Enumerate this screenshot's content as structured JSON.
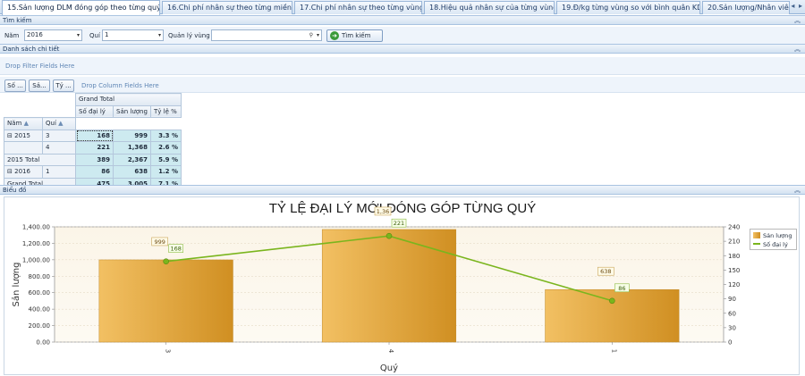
{
  "tabs": [
    {
      "label": "15.Sản lượng DLM đóng góp theo từng quý",
      "active": true
    },
    {
      "label": "16.Chi phí nhân sự theo từng miền",
      "active": false
    },
    {
      "label": "17.Chi phí nhân sự theo từng vùng",
      "active": false
    },
    {
      "label": "18.Hiệu quả nhân sự của từng vùng",
      "active": false
    },
    {
      "label": "19.Đ/kg từng vùng so với bình quân KD",
      "active": false
    },
    {
      "label": "20.Sản lượng/Nhân viê",
      "active": false
    }
  ],
  "tab_arrows": "◂ ▸",
  "search_group": {
    "title": "Tìm kiếm",
    "year_label": "Năm",
    "year_value": "2016",
    "quarter_label": "Quí",
    "quarter_value": "1",
    "region_label": "Quản lý vùng",
    "region_value": "",
    "search_button": "Tìm kiếm"
  },
  "detail_group": {
    "title": "Danh sách chi tiết",
    "drop_filter": "Drop Filter Fields Here",
    "drop_column": "Drop Column Fields Here",
    "field_buttons": [
      "Số ...",
      "Sả...",
      "Tỷ ..."
    ]
  },
  "pivot": {
    "grand_total_header": "Grand Total",
    "row_headers": [
      "Năm",
      "Quí"
    ],
    "column_headers": [
      "Số đại lý",
      "Sản lượng",
      "Tỷ lệ %"
    ],
    "rows": [
      {
        "year": "2015",
        "quarter": "3",
        "values": [
          "168",
          "999",
          "3.3 %"
        ]
      },
      {
        "year": "",
        "quarter": "4",
        "values": [
          "221",
          "1,368",
          "2.6 %"
        ]
      },
      {
        "year": "2015 Total",
        "quarter": "",
        "values": [
          "389",
          "2,367",
          "5.9 %"
        ]
      },
      {
        "year": "2016",
        "quarter": "1",
        "values": [
          "86",
          "638",
          "1.2 %"
        ]
      },
      {
        "year": "Grand Total",
        "quarter": "",
        "values": [
          "475",
          "3,005",
          "7.1 %"
        ]
      }
    ]
  },
  "chart_group": {
    "title": "Biểu đồ"
  },
  "chart_data": {
    "type": "bar",
    "title": "TỶ LỆ ĐẠI LÝ MỚI ĐÓNG GÓP TỪNG QUÝ",
    "xlabel": "Quý",
    "ylabel": "Sản lượng",
    "categories": [
      "3",
      "4",
      "1"
    ],
    "ylim": [
      0,
      1400
    ],
    "yticks": [
      "0.00",
      "200.00",
      "400.00",
      "600.00",
      "800.00",
      "1,000.00",
      "1,200.00",
      "1,400.00"
    ],
    "y2lim": [
      0,
      240
    ],
    "y2ticks": [
      "0",
      "30",
      "60",
      "90",
      "120",
      "150",
      "180",
      "210",
      "240"
    ],
    "series": [
      {
        "name": "Sản lượng",
        "type": "bar",
        "values": [
          999,
          1368,
          638
        ],
        "labels": [
          "999",
          "1,36",
          "638"
        ],
        "color": "#e3a53e"
      },
      {
        "name": "Số đại lý",
        "type": "line",
        "axis": "secondary",
        "values": [
          168,
          221,
          86
        ],
        "labels": [
          "168",
          "221",
          "86"
        ],
        "color": "#7ab51d"
      }
    ],
    "legend_position": "top-right",
    "grid": true
  }
}
